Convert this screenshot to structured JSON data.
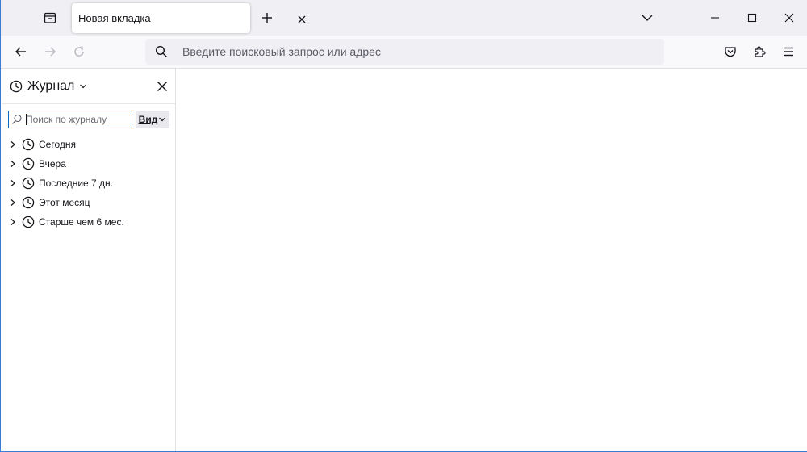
{
  "tabstrip": {
    "tabs": [
      {
        "title": "Новая вкладка"
      }
    ]
  },
  "navbar": {
    "url_placeholder": "Введите поисковый запрос или адрес"
  },
  "sidebar": {
    "title": "Журнал",
    "search_placeholder": "Поиск по журналу",
    "view_label": "Вид",
    "items": [
      {
        "label": "Сегодня"
      },
      {
        "label": "Вчера"
      },
      {
        "label": "Последние 7 дн."
      },
      {
        "label": "Этот месяц"
      },
      {
        "label": "Старше чем 6 мес."
      }
    ]
  },
  "colors": {
    "accent": "#0a6cc4",
    "window_border": "#3b7bd6",
    "tabstrip_bg": "#f0f0f4",
    "urlbar_bg": "#f0f0f4"
  },
  "icons": {
    "tab_list": "firefox-view-icon",
    "tab_close": "close-icon",
    "new_tab": "plus-icon",
    "list_all_tabs": "chevron-down-icon",
    "back": "arrow-left-icon",
    "forward": "arrow-right-icon",
    "reload": "reload-icon",
    "search": "search-icon",
    "pocket": "pocket-icon",
    "extensions": "puzzle-icon",
    "menu": "hamburger-icon",
    "history": "clock-icon"
  }
}
